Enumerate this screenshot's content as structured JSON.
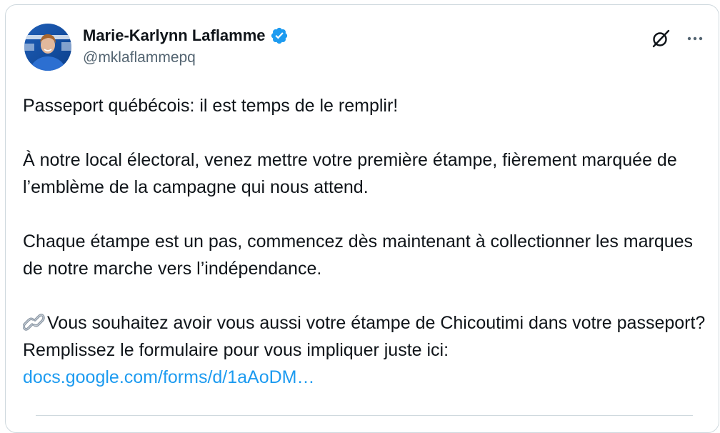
{
  "author": {
    "display_name": "Marie-Karlynn Laflamme",
    "handle": "@mklaflammepq",
    "verified": true,
    "avatar_icon": "profile-photo"
  },
  "actions": {
    "grok_icon": "slash-circle-icon",
    "more_icon": "ellipsis-icon"
  },
  "tweet": {
    "para1": "Passeport québécois: il est temps de le remplir!",
    "para2": "À notre local électoral, venez mettre votre première étampe, fièrement marquée de l’emblème de la campagne qui nous attend.",
    "para3": "Chaque étampe est un pas, commencez dès maintenant à collectionner les marques de notre marche vers l’indépendance.",
    "para4_emoji": "link-emoji",
    "para4": "Vous souhaitez avoir vous aussi votre étampe de Chicoutimi dans votre passeport? Remplissez le formulaire pour vous impliquer juste ici:",
    "link": "docs.google.com/forms/d/1aAoDM…"
  },
  "colors": {
    "text": "#0f1419",
    "secondary": "#536471",
    "accent": "#1d9bf0",
    "border": "#cfd9de"
  }
}
